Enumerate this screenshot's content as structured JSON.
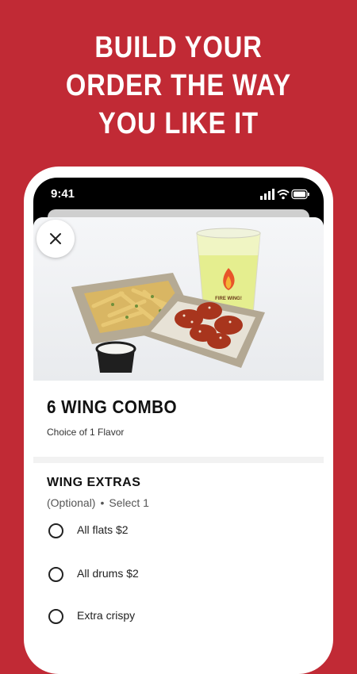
{
  "headline": [
    "BUILD YOUR",
    "ORDER THE WAY",
    "YOU LIKE IT"
  ],
  "status_bar": {
    "time": "9:41"
  },
  "hero": {
    "cup_brand": "FIRE WING!"
  },
  "item": {
    "title": "6 WING COMBO",
    "subtitle": "Choice of 1 Flavor"
  },
  "extras": {
    "title": "WING EXTRAS",
    "optional": "(Optional)",
    "select": "Select 1",
    "options": [
      {
        "label": "All flats $2"
      },
      {
        "label": "All drums $2"
      },
      {
        "label": "Extra crispy"
      }
    ]
  },
  "colors": {
    "brand_red": "#c12a35"
  }
}
